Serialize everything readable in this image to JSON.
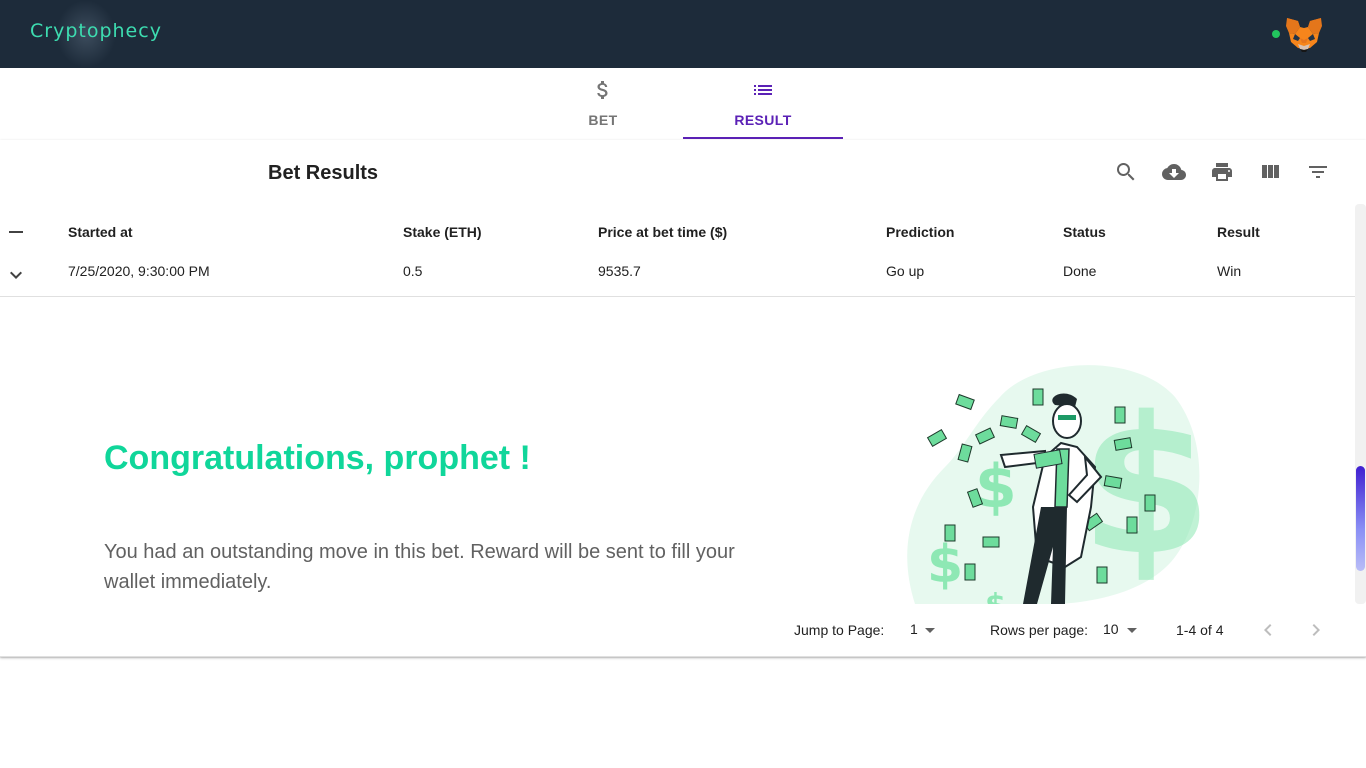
{
  "app": {
    "brand": "Cryptophecy",
    "wallet_icon": "metamask-fox-icon",
    "connection_status_color": "#22c55e"
  },
  "tabs": [
    {
      "label": "BET",
      "icon": "dollar-icon",
      "active": false
    },
    {
      "label": "RESULT",
      "icon": "list-icon",
      "active": true
    }
  ],
  "table": {
    "title": "Bet Results",
    "toolbar": [
      "search-icon",
      "download-icon",
      "print-icon",
      "view-columns-icon",
      "filter-icon"
    ],
    "columns": [
      "Started at",
      "Stake (ETH)",
      "Price at bet time ($)",
      "Prediction",
      "Status",
      "Result"
    ],
    "rows": [
      {
        "started_at": "7/25/2020, 9:30:00 PM",
        "stake": "0.5",
        "price": "9535.7",
        "prediction": "Go up",
        "status": "Done",
        "result": "Win"
      }
    ],
    "expanded": {
      "heading": "Congratulations, prophet !",
      "message": "You had an outstanding move in this bet. Reward will be sent to fill your wallet immediately."
    },
    "footer": {
      "jump_label": "Jump to Page:",
      "jump_value": "1",
      "rows_label": "Rows per page:",
      "rows_value": "10",
      "range": "1-4 of 4"
    }
  },
  "colors": {
    "appbar": "#1d2b3a",
    "brand": "#3ddcb0",
    "accent": "#5b21b6",
    "success": "#10d69a"
  }
}
